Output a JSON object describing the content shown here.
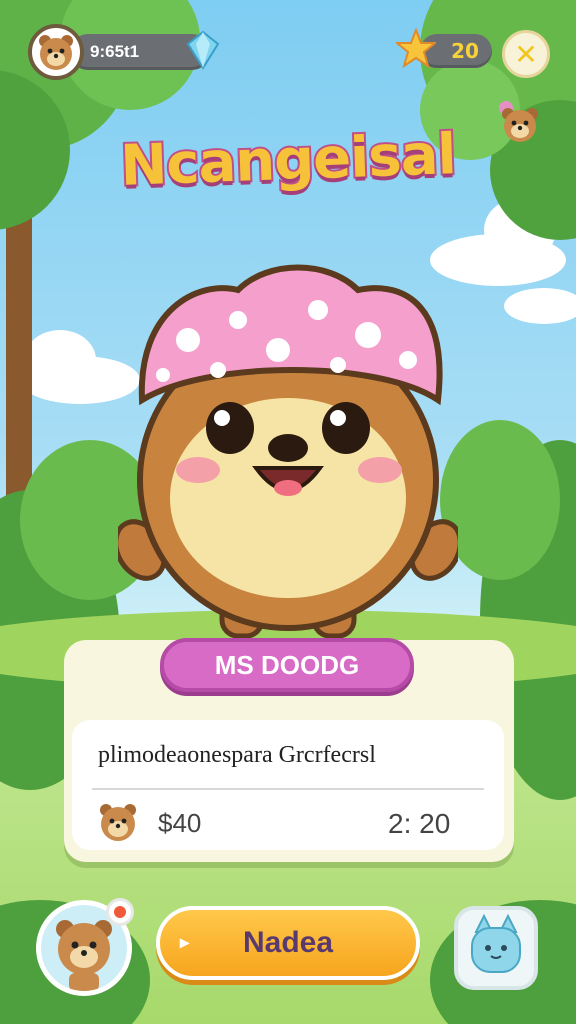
{
  "hud": {
    "time_text": "9:65t1",
    "stars_count": "20",
    "close_label": "✕"
  },
  "title": "Ncangeisal",
  "card": {
    "name_label": "MS DOODG",
    "description": "plimodeaonespara Grcrfecrsl",
    "price": "$40",
    "timer": "2: 20"
  },
  "actions": {
    "main_button_label": "Nadea",
    "play_glyph": "▸"
  },
  "colors": {
    "accent_pink": "#d76bc5",
    "button_orange": "#f7a51e",
    "title_yellow": "#f6c23a"
  }
}
